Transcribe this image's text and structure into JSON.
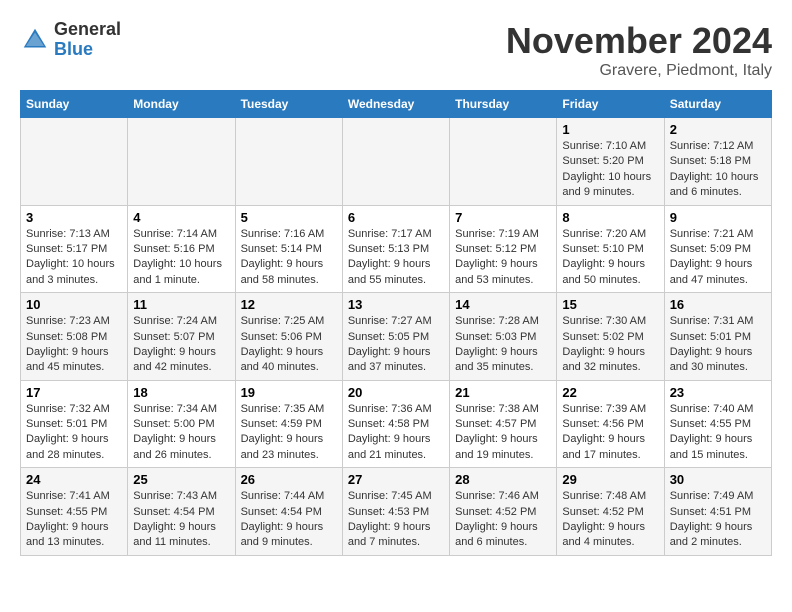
{
  "header": {
    "logo_general": "General",
    "logo_blue": "Blue",
    "month_title": "November 2024",
    "location": "Gravere, Piedmont, Italy"
  },
  "days_of_week": [
    "Sunday",
    "Monday",
    "Tuesday",
    "Wednesday",
    "Thursday",
    "Friday",
    "Saturday"
  ],
  "weeks": [
    [
      {
        "day": "",
        "info": ""
      },
      {
        "day": "",
        "info": ""
      },
      {
        "day": "",
        "info": ""
      },
      {
        "day": "",
        "info": ""
      },
      {
        "day": "",
        "info": ""
      },
      {
        "day": "1",
        "info": "Sunrise: 7:10 AM\nSunset: 5:20 PM\nDaylight: 10 hours and 9 minutes."
      },
      {
        "day": "2",
        "info": "Sunrise: 7:12 AM\nSunset: 5:18 PM\nDaylight: 10 hours and 6 minutes."
      }
    ],
    [
      {
        "day": "3",
        "info": "Sunrise: 7:13 AM\nSunset: 5:17 PM\nDaylight: 10 hours and 3 minutes."
      },
      {
        "day": "4",
        "info": "Sunrise: 7:14 AM\nSunset: 5:16 PM\nDaylight: 10 hours and 1 minute."
      },
      {
        "day": "5",
        "info": "Sunrise: 7:16 AM\nSunset: 5:14 PM\nDaylight: 9 hours and 58 minutes."
      },
      {
        "day": "6",
        "info": "Sunrise: 7:17 AM\nSunset: 5:13 PM\nDaylight: 9 hours and 55 minutes."
      },
      {
        "day": "7",
        "info": "Sunrise: 7:19 AM\nSunset: 5:12 PM\nDaylight: 9 hours and 53 minutes."
      },
      {
        "day": "8",
        "info": "Sunrise: 7:20 AM\nSunset: 5:10 PM\nDaylight: 9 hours and 50 minutes."
      },
      {
        "day": "9",
        "info": "Sunrise: 7:21 AM\nSunset: 5:09 PM\nDaylight: 9 hours and 47 minutes."
      }
    ],
    [
      {
        "day": "10",
        "info": "Sunrise: 7:23 AM\nSunset: 5:08 PM\nDaylight: 9 hours and 45 minutes."
      },
      {
        "day": "11",
        "info": "Sunrise: 7:24 AM\nSunset: 5:07 PM\nDaylight: 9 hours and 42 minutes."
      },
      {
        "day": "12",
        "info": "Sunrise: 7:25 AM\nSunset: 5:06 PM\nDaylight: 9 hours and 40 minutes."
      },
      {
        "day": "13",
        "info": "Sunrise: 7:27 AM\nSunset: 5:05 PM\nDaylight: 9 hours and 37 minutes."
      },
      {
        "day": "14",
        "info": "Sunrise: 7:28 AM\nSunset: 5:03 PM\nDaylight: 9 hours and 35 minutes."
      },
      {
        "day": "15",
        "info": "Sunrise: 7:30 AM\nSunset: 5:02 PM\nDaylight: 9 hours and 32 minutes."
      },
      {
        "day": "16",
        "info": "Sunrise: 7:31 AM\nSunset: 5:01 PM\nDaylight: 9 hours and 30 minutes."
      }
    ],
    [
      {
        "day": "17",
        "info": "Sunrise: 7:32 AM\nSunset: 5:01 PM\nDaylight: 9 hours and 28 minutes."
      },
      {
        "day": "18",
        "info": "Sunrise: 7:34 AM\nSunset: 5:00 PM\nDaylight: 9 hours and 26 minutes."
      },
      {
        "day": "19",
        "info": "Sunrise: 7:35 AM\nSunset: 4:59 PM\nDaylight: 9 hours and 23 minutes."
      },
      {
        "day": "20",
        "info": "Sunrise: 7:36 AM\nSunset: 4:58 PM\nDaylight: 9 hours and 21 minutes."
      },
      {
        "day": "21",
        "info": "Sunrise: 7:38 AM\nSunset: 4:57 PM\nDaylight: 9 hours and 19 minutes."
      },
      {
        "day": "22",
        "info": "Sunrise: 7:39 AM\nSunset: 4:56 PM\nDaylight: 9 hours and 17 minutes."
      },
      {
        "day": "23",
        "info": "Sunrise: 7:40 AM\nSunset: 4:55 PM\nDaylight: 9 hours and 15 minutes."
      }
    ],
    [
      {
        "day": "24",
        "info": "Sunrise: 7:41 AM\nSunset: 4:55 PM\nDaylight: 9 hours and 13 minutes."
      },
      {
        "day": "25",
        "info": "Sunrise: 7:43 AM\nSunset: 4:54 PM\nDaylight: 9 hours and 11 minutes."
      },
      {
        "day": "26",
        "info": "Sunrise: 7:44 AM\nSunset: 4:54 PM\nDaylight: 9 hours and 9 minutes."
      },
      {
        "day": "27",
        "info": "Sunrise: 7:45 AM\nSunset: 4:53 PM\nDaylight: 9 hours and 7 minutes."
      },
      {
        "day": "28",
        "info": "Sunrise: 7:46 AM\nSunset: 4:52 PM\nDaylight: 9 hours and 6 minutes."
      },
      {
        "day": "29",
        "info": "Sunrise: 7:48 AM\nSunset: 4:52 PM\nDaylight: 9 hours and 4 minutes."
      },
      {
        "day": "30",
        "info": "Sunrise: 7:49 AM\nSunset: 4:51 PM\nDaylight: 9 hours and 2 minutes."
      }
    ]
  ]
}
